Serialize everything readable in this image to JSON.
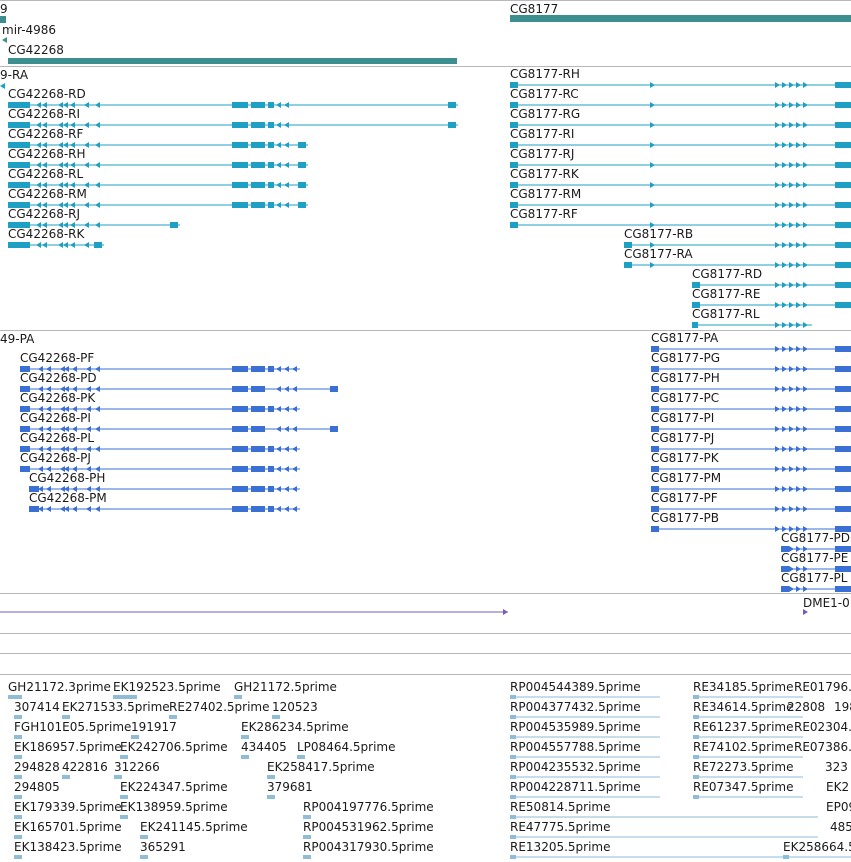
{
  "colors": {
    "gene": "#3d8f8f",
    "transcript_ra": "#1e9fc4",
    "transcript_pa": "#3a6fd4",
    "ncrna": "#7a5bb5",
    "est": "#8fbcd6",
    "separator": "#b8b8b8"
  },
  "genes": {
    "left_cut": "9",
    "mir": "mir-4986",
    "cg42268": "CG42268",
    "cg8177": "CG8177"
  },
  "tracks": {
    "ra_left": "9-RA",
    "pa_left": "49-PA",
    "dme": "DME1-0"
  },
  "transcripts_ra_left": [
    "CG42268-RD",
    "CG42268-RI",
    "CG42268-RF",
    "CG42268-RH",
    "CG42268-RL",
    "CG42268-RM",
    "CG42268-RJ",
    "CG42268-RK"
  ],
  "transcripts_ra_right": [
    "CG8177-RH",
    "CG8177-RC",
    "CG8177-RG",
    "CG8177-RI",
    "CG8177-RJ",
    "CG8177-RK",
    "CG8177-RM",
    "CG8177-RF",
    "CG8177-RB",
    "CG8177-RA",
    "CG8177-RD",
    "CG8177-RE",
    "CG8177-RL"
  ],
  "transcripts_pa_left": [
    "CG42268-PF",
    "CG42268-PD",
    "CG42268-PK",
    "CG42268-PI",
    "CG42268-PL",
    "CG42268-PJ",
    "CG42268-PH",
    "CG42268-PM"
  ],
  "transcripts_pa_right": [
    "CG8177-PA",
    "CG8177-PG",
    "CG8177-PH",
    "CG8177-PC",
    "CG8177-PI",
    "CG8177-PJ",
    "CG8177-PK",
    "CG8177-PM",
    "CG8177-PF",
    "CG8177-PB",
    "CG8177-PD",
    "CG8177-PE",
    "CG8177-PL"
  ],
  "ests": {
    "c1": [
      "GH21172.3prime",
      "307414",
      "FGH101E05.5prime",
      "EK186957.5prime",
      "294828",
      "294805",
      "EK179339.5prime",
      "EK165701.5prime",
      "EK138423.5prime"
    ],
    "c2": [
      "EK192523.5prime",
      "EK271533.5prime",
      "191917",
      "EK242706.5prime",
      "422816",
      "312266",
      "EK224347.5prime",
      "EK138959.5prime",
      "EK241145.5prime",
      "365291"
    ],
    "c3": [
      "GH21172.5prime",
      "RE27402.5prime",
      "120523",
      "EK286234.5prime",
      "434405",
      "LP08464.5prime",
      "EK258417.5prime",
      "379681",
      "RP004197776.5prime",
      "RP004531962.5prime",
      "RP004317930.5prime"
    ],
    "c4": [
      "RP004544389.5prime",
      "RP004377432.5prime",
      "RP004535989.5prime",
      "RP004557788.5prime",
      "RP004235532.5prime",
      "RP004228711.5prime",
      "RE50814.5prime",
      "RE47775.5prime",
      "RE13205.5prime"
    ],
    "c5": [
      "RE34185.5prime",
      "RE34614.5prime",
      "RE61237.5prime",
      "RE74102.5prime",
      "RE72273.5prime",
      "RE07347.5prime",
      "EK258664.5"
    ],
    "c6": [
      "RE01796.",
      "22808",
      "RE02304.",
      "RE07386.",
      "323",
      "EK2",
      "EP09",
      "485",
      "198"
    ]
  }
}
